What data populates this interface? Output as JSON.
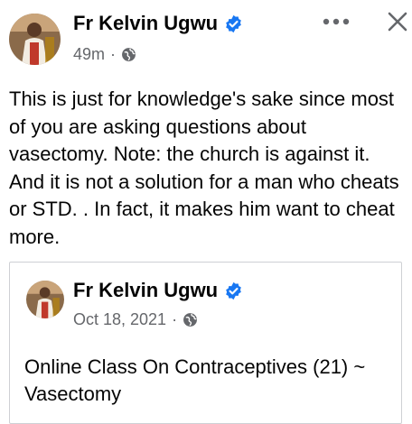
{
  "post": {
    "author": "Fr Kelvin Ugwu",
    "time": "49m",
    "separator": "·",
    "audience_icon": "globe-icon",
    "text": "This is just for knowledge's sake since most of you are asking questions about vasectomy. Note: the church is against it. And it is not a solution for a man who cheats or STD. . In fact, it makes him want to cheat more."
  },
  "shared_post": {
    "author": "Fr Kelvin Ugwu",
    "time": "Oct 18, 2021",
    "separator": "·",
    "audience_icon": "globe-icon",
    "text": "Online Class On Contraceptives (21) ~ Vasectomy"
  },
  "header_actions": {
    "more_icon": "more-dots-icon",
    "close_icon": "close-icon"
  },
  "colors": {
    "verified_blue": "#1877f2",
    "meta_gray": "#65676b",
    "text": "#050505",
    "border": "#ced0d4"
  }
}
